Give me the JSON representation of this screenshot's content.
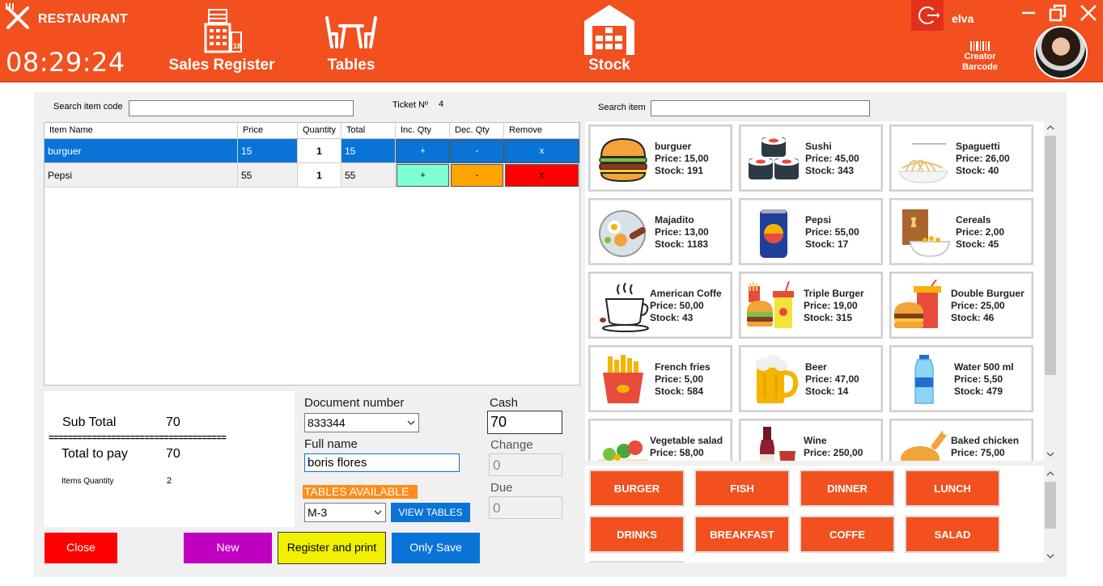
{
  "header": {
    "brand": "RESTAURANT",
    "clock": "08:29:24",
    "nav": [
      {
        "label": "Sales Register",
        "icon": "cash-register-icon"
      },
      {
        "label": "Tables",
        "icon": "table-chairs-icon"
      },
      {
        "label": "Stock",
        "icon": "warehouse-icon"
      }
    ],
    "user": "elva",
    "creator_line1": "Creator",
    "creator_line2": "Barcode",
    "colors": {
      "accent": "#f2501e",
      "logout_bg": "#e2301a"
    }
  },
  "sale": {
    "search_item_code_label": "Search item code",
    "search_item_code_value": "",
    "ticket_label": "Ticket Nº",
    "ticket_number": "4",
    "columns": [
      "Item Name",
      "Price",
      "Quantity",
      "Total",
      "Inc. Qty",
      "Dec. Qty",
      "Remove"
    ],
    "rows": [
      {
        "name": "burguer",
        "price": "15",
        "quantity": "1",
        "total": "15",
        "inc": "+",
        "dec": "-",
        "remove": "x",
        "selected": true
      },
      {
        "name": "Pepsi",
        "price": "55",
        "quantity": "1",
        "total": "55",
        "inc": "+",
        "dec": "-",
        "remove": "x",
        "selected": false
      }
    ]
  },
  "totals": {
    "subtotal_label": "Sub Total",
    "subtotal_value": "70",
    "separator": "=====================================",
    "total_label": "Total to pay",
    "total_value": "70",
    "items_qty_label": "Items Quantity",
    "items_qty_value": "2"
  },
  "customer": {
    "doc_label": "Document number",
    "doc_value": "833344",
    "name_label": "Full name",
    "name_value": "boris flores",
    "tables_label": "TABLES AVAILABLE",
    "table_value": "M-3",
    "view_tables": "VIEW TABLES"
  },
  "payment": {
    "cash_label": "Cash",
    "cash_value": "70",
    "change_label": "Change",
    "change_value": "0",
    "due_label": "Due",
    "due_value": "0"
  },
  "buttons": {
    "close": "Close",
    "new": "New",
    "register_print": "Register and print",
    "only_save": "Only Save"
  },
  "catalog": {
    "search_label": "Search item",
    "search_value": "",
    "items": [
      {
        "name": "burguer",
        "price": "Price: 15,00",
        "stock": "Stock: 191",
        "icon": "burger-icon"
      },
      {
        "name": "Sushi",
        "price": "Price: 45,00",
        "stock": "Stock: 343",
        "icon": "sushi-icon"
      },
      {
        "name": "Spaguetti",
        "price": "Price: 26,00",
        "stock": "Stock: 40",
        "icon": "spaghetti-icon"
      },
      {
        "name": "Majadito",
        "price": "Price: 13,00",
        "stock": "Stock: 1183",
        "icon": "plate-meal-icon"
      },
      {
        "name": "Pepsi",
        "price": "Price: 55,00",
        "stock": "Stock: 17",
        "icon": "soda-can-icon"
      },
      {
        "name": "Cereals",
        "price": "Price: 2,00",
        "stock": "Stock: 45",
        "icon": "cereal-icon"
      },
      {
        "name": "American Coffe",
        "price": "Price: 50,00",
        "stock": "Stock: 43",
        "icon": "coffee-cup-icon"
      },
      {
        "name": "Triple Burger",
        "price": "Price: 19,00",
        "stock": "Stock: 315",
        "icon": "burger-combo-icon"
      },
      {
        "name": "Double Burguer",
        "price": "Price: 25,00",
        "stock": "Stock: 46",
        "icon": "burger-drink-icon"
      },
      {
        "name": "French fries",
        "price": "Price: 5,00",
        "stock": "Stock: 584",
        "icon": "fries-icon"
      },
      {
        "name": "Beer",
        "price": "Price: 47,00",
        "stock": "Stock: 14",
        "icon": "beer-mug-icon"
      },
      {
        "name": "Water 500 ml",
        "price": "Price: 5,50",
        "stock": "Stock: 479",
        "icon": "water-bottle-icon"
      },
      {
        "name": "Vegetable salad",
        "price": "Price: 58,00",
        "stock": "",
        "icon": "salad-icon"
      },
      {
        "name": "Wine",
        "price": "Price: 250,00",
        "stock": "",
        "icon": "wine-icon"
      },
      {
        "name": "Baked chicken",
        "price": "Price: 75,00",
        "stock": "",
        "icon": "chicken-icon"
      }
    ],
    "categories": [
      "BURGER",
      "FISH",
      "DINNER",
      "LUNCH",
      "DRINKS",
      "BREAKFAST",
      "COFFE",
      "SALAD"
    ]
  }
}
